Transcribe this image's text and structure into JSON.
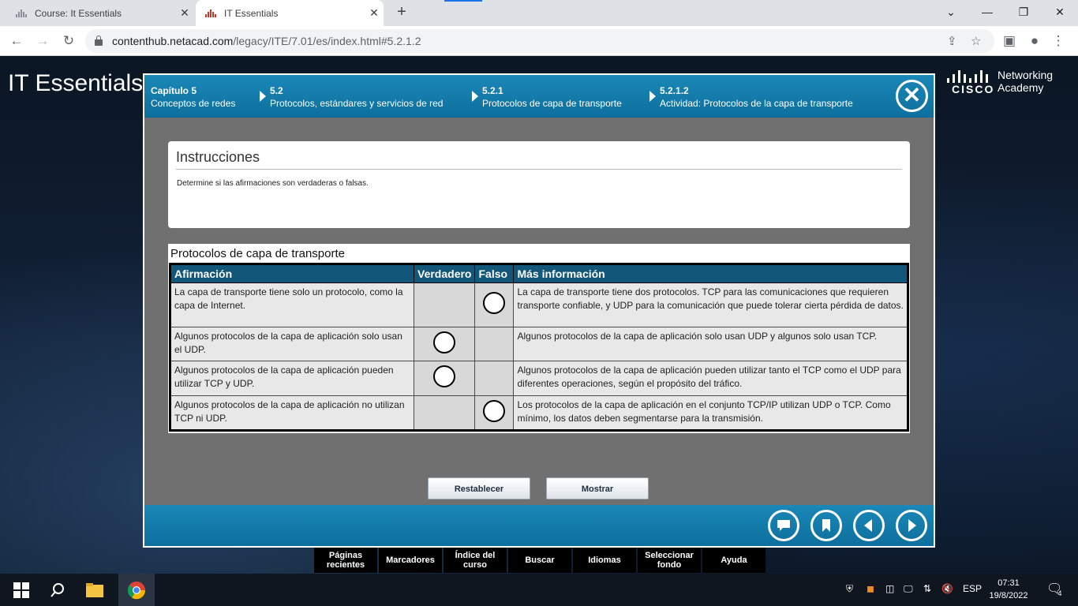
{
  "browser": {
    "tabs": [
      {
        "title": "Course: It Essentials",
        "close": "✕"
      },
      {
        "title": "IT Essentials",
        "close": "✕"
      }
    ],
    "new_tab": "+",
    "window_controls": {
      "minimize": "⌄",
      "restore": "—",
      "maximize": "❐",
      "close": "✕"
    },
    "url_host": "contenthub.netacad.com",
    "url_path": "/legacy/ITE/7.01/es/index.html#5.2.1.2"
  },
  "page": {
    "course_title": "IT Essentials",
    "logo": {
      "word": "CISCO",
      "line1": "Networking",
      "line2": "Academy"
    }
  },
  "breadcrumb": [
    {
      "num": "Capítulo 5",
      "label": "Conceptos de redes"
    },
    {
      "num": "5.2",
      "label": "Protocolos, estándares y servicios de red"
    },
    {
      "num": "5.2.1",
      "label": "Protocolos de capa de transporte"
    },
    {
      "num": "5.2.1.2",
      "label": "Actividad: Protocolos de la capa de transporte"
    }
  ],
  "instructions": {
    "title": "Instrucciones",
    "text": "Determine si las afirmaciones son verdaderas o falsas."
  },
  "activity": {
    "title": "Protocolos de capa de transporte",
    "headers": [
      "Afirmación",
      "Verdadero",
      "Falso",
      "Más información"
    ],
    "rows": [
      {
        "statement": "La capa de transporte tiene solo un protocolo, como la capa de Internet.",
        "answer": "falso",
        "info": "La capa de transporte tiene dos protocolos. TCP para las comunicaciones que requieren transporte confiable, y UDP para la comunicación que puede tolerar cierta pérdida de datos."
      },
      {
        "statement": "Algunos protocolos de la capa de aplicación solo usan el UDP.",
        "answer": "verdadero",
        "info": "Algunos protocolos de la capa de aplicación solo usan UDP y algunos solo usan TCP."
      },
      {
        "statement": "Algunos protocolos de la capa de aplicación pueden utilizar TCP y UDP.",
        "answer": "verdadero",
        "info": "Algunos protocolos de la capa de aplicación pueden utilizar tanto el TCP como el UDP para diferentes operaciones, según el propósito del tráfico."
      },
      {
        "statement": "Algunos protocolos de la capa de aplicación no utilizan TCP ni UDP.",
        "answer": "falso",
        "info": "Los protocolos de la capa de aplicación en el conjunto TCP/IP utilizan UDP o TCP. Como mínimo, los datos deben segmentarse para la transmisión."
      }
    ],
    "buttons": {
      "reset": "Restablecer",
      "show": "Mostrar"
    }
  },
  "footer_nav": [
    "chat-icon",
    "bookmark-icon",
    "previous-icon",
    "next-icon"
  ],
  "bottom_menu": [
    {
      "line1": "Páginas",
      "line2": "recientes"
    },
    {
      "line1": "Marcadores",
      "line2": ""
    },
    {
      "line1": "Índice del",
      "line2": "curso"
    },
    {
      "line1": "Buscar",
      "line2": ""
    },
    {
      "line1": "Idiomas",
      "line2": ""
    },
    {
      "line1": "Seleccionar",
      "line2": "fondo"
    },
    {
      "line1": "Ayuda",
      "line2": ""
    }
  ],
  "taskbar": {
    "language": "ESP",
    "time": "07:31",
    "date": "19/8/2022",
    "notifications": "4"
  },
  "colors": {
    "accent": "#1a88b8",
    "table_header": "#12577a"
  }
}
